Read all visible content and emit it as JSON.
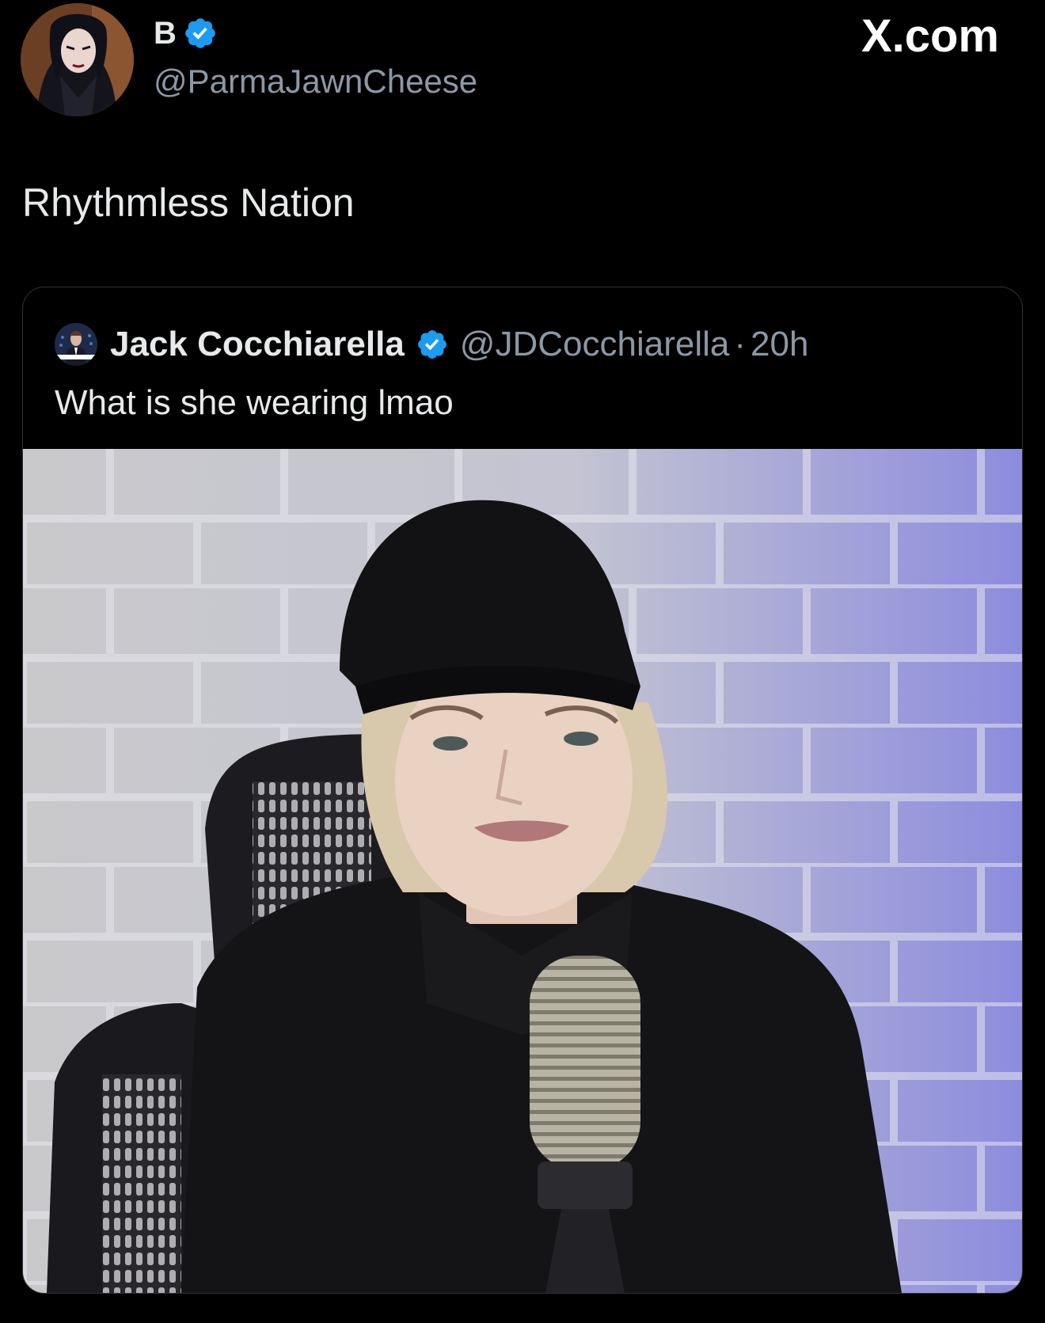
{
  "brand": {
    "label": "X.com"
  },
  "author": {
    "name": "B",
    "handle": "@ParmaJawnCheese",
    "verified": true,
    "avatar_icon": "cartoon-character-avatar"
  },
  "post": {
    "text": "Rhythmless Nation"
  },
  "quote": {
    "name": "Jack Cocchiarella",
    "handle": "@JDCocchiarella",
    "separator": "·",
    "time": "20h",
    "verified": true,
    "text": "What is she wearing lmao",
    "media": {
      "icon": "video-still-image"
    }
  },
  "colors": {
    "background": "#000000",
    "text_primary": "#e7e9ea",
    "text_secondary": "#8b98a5",
    "verified_blue": "#1d9bf0",
    "border": "#2f3336"
  }
}
